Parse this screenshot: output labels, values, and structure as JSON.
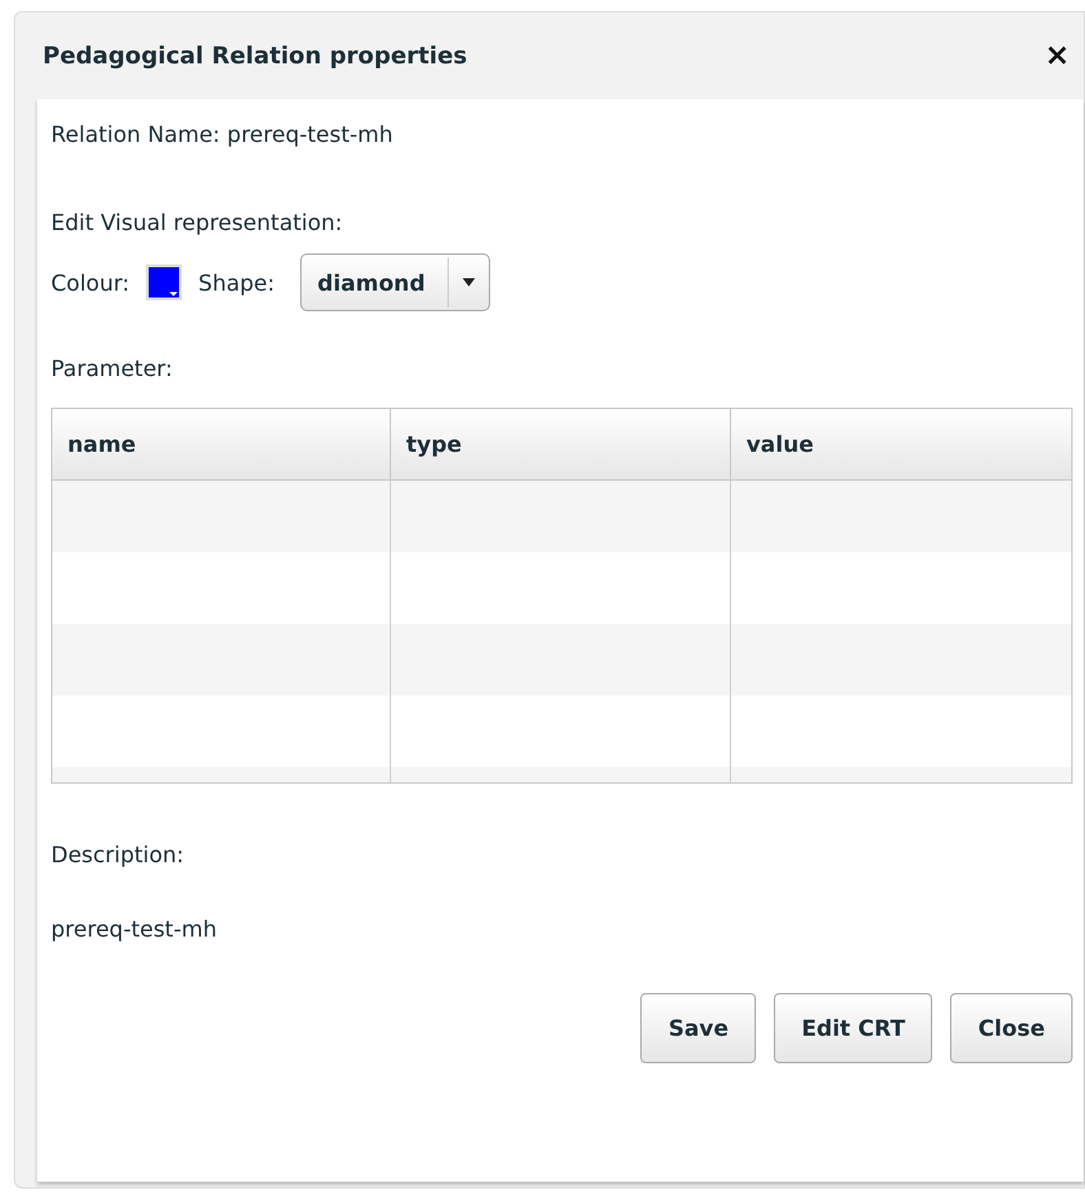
{
  "dialog": {
    "title": "Pedagogical Relation properties",
    "close_icon": "×"
  },
  "relation_name": "Relation Name: prereq-test-mh",
  "visual_heading": "Edit Visual representation:",
  "colour": {
    "label": "Colour:",
    "color": "#0000ff"
  },
  "shape": {
    "label": "Shape:",
    "value": "diamond"
  },
  "parameter_heading": "Parameter:",
  "table": {
    "columns": [
      "name",
      "type",
      "value"
    ]
  },
  "description_heading": "Description:",
  "description": "prereq-test-mh",
  "buttons": [
    "Save",
    "Edit CRT",
    "Close"
  ]
}
